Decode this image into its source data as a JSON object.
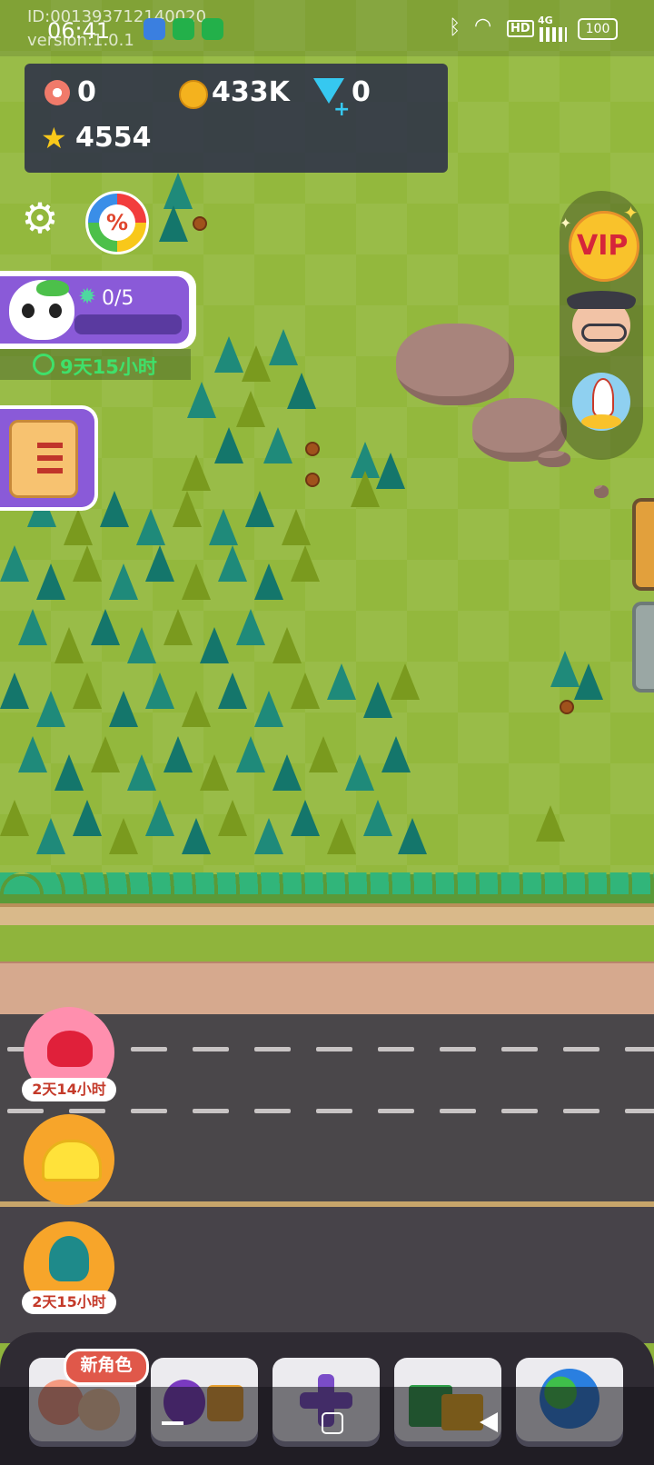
{
  "status_bar": {
    "id_text": "ID:001393712140020",
    "version_text": "version:1.0.1",
    "time": "06:41",
    "network_hd": "HD",
    "network_gen": "4G",
    "battery": "100"
  },
  "resources": {
    "candy": "0",
    "coins": "433K",
    "gems": "0",
    "stars": "4554"
  },
  "quest": {
    "progress": "0/5",
    "progress_fraction": 0,
    "timer": "9天15小时"
  },
  "events": [
    {
      "icon": "gift-bow-icon",
      "timer": "2天14小时",
      "color": "#ff8fae"
    },
    {
      "icon": "hard-hat-icon",
      "timer": "",
      "color": "#f7a52a"
    },
    {
      "icon": "octopus-icon",
      "timer": "2天15小时",
      "color": "#f7a52a"
    }
  ],
  "right_menu": {
    "vip_label": "VIP"
  },
  "bottom_tabs": [
    {
      "name": "characters",
      "badge": "新角色"
    },
    {
      "name": "guild"
    },
    {
      "name": "build"
    },
    {
      "name": "shop"
    },
    {
      "name": "world"
    }
  ],
  "colors": {
    "panel": "#2c3048",
    "quest_purple": "#8a5ad8",
    "timer_green": "#3fe06a",
    "badge_red": "#e0584a"
  }
}
